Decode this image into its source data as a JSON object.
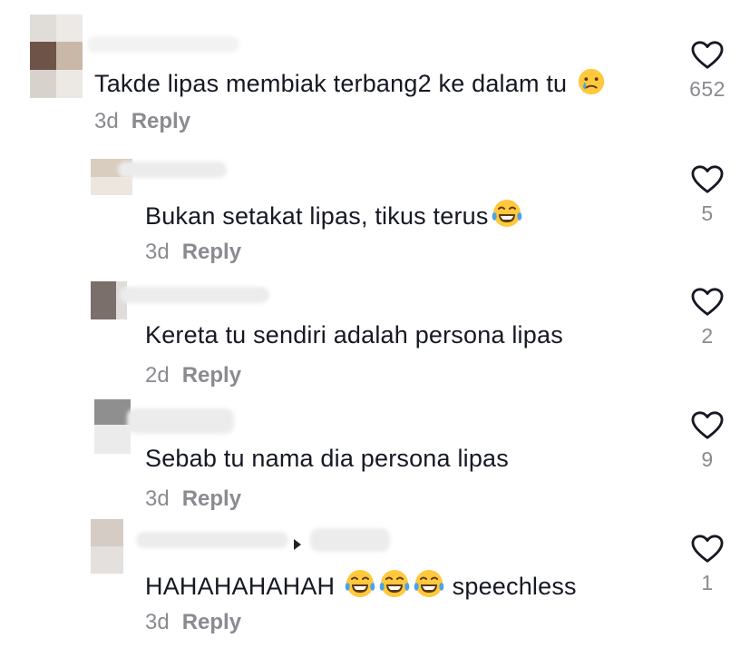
{
  "comments": [
    {
      "text": "Takde lipas membiak terbang2 ke dalam tu",
      "emoji": "crying-face",
      "time": "3d",
      "reply_label": "Reply",
      "likes": "652"
    },
    {
      "text": "Bukan setakat lipas, tikus terus",
      "emoji": "tears-of-joy",
      "time": "3d",
      "reply_label": "Reply",
      "likes": "5"
    },
    {
      "text": "Kereta tu sendiri adalah persona lipas",
      "time": "2d",
      "reply_label": "Reply",
      "likes": "2"
    },
    {
      "text": "Sebab tu nama dia persona lipas",
      "time": "3d",
      "reply_label": "Reply",
      "likes": "9"
    },
    {
      "text_before": "HAHAHAHAHAH",
      "emoji": "tears-of-joy",
      "text_after": "speechless",
      "time": "3d",
      "reply_label": "Reply",
      "likes": "1"
    }
  ],
  "icons": {
    "like": "heart-outline-icon",
    "reply_to": "reply-arrow-icon"
  },
  "colors": {
    "text": "#161823",
    "secondary": "#8a8b91",
    "emoji_face": "#ffc83d",
    "emoji_tear": "#4aa3e8"
  }
}
